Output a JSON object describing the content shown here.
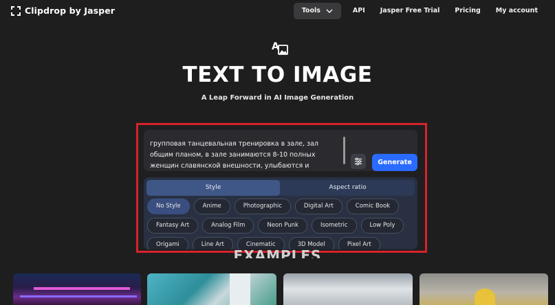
{
  "brand": {
    "name": "Clipdrop by Jasper",
    "logo_icon": "clipdrop-logo-icon"
  },
  "nav": {
    "tools_label": "Tools",
    "api_label": "API",
    "free_trial_label": "Jasper Free Trial",
    "pricing_label": "Pricing",
    "account_label": "My account"
  },
  "hero": {
    "icon": "text-to-image-icon",
    "title": "TEXT TO IMAGE",
    "subtitle": "A Leap Forward in AI Image Generation"
  },
  "prompt": {
    "line1": "групповая танцевальная тренировка в зале, зал",
    "line2": "общим планом, в зале занимаются 8-10 полных",
    "line3": "женщин славянской внешности, улыбаются и"
  },
  "generate_label": "Generate",
  "tabs": {
    "style": "Style",
    "aspect_ratio": "Aspect ratio"
  },
  "styles": {
    "row1": [
      "No Style",
      "Anime",
      "Photographic",
      "Digital Art",
      "Comic Book"
    ],
    "row2": [
      "Fantasy Art",
      "Analog Film",
      "Neon Punk",
      "Isometric",
      "Low Poly"
    ],
    "row3": [
      "Origami",
      "Line Art",
      "Cinematic",
      "3D Model",
      "Pixel Art"
    ],
    "selected": "No Style"
  },
  "examples_heading": "EXAMPLES",
  "colors": {
    "accent": "#2a6bff",
    "highlight_border": "#d9222a",
    "background": "#1e1e1f"
  }
}
